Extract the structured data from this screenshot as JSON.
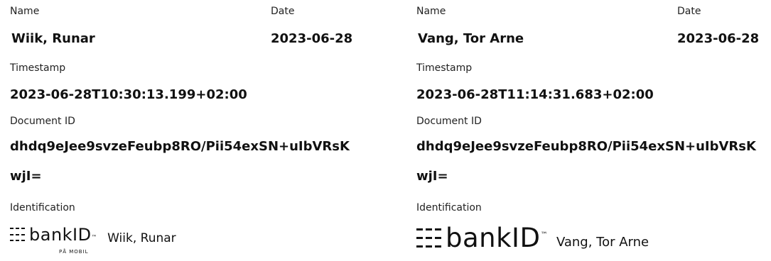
{
  "signatures": [
    {
      "name_label": "Name",
      "name": "Wiik, Runar",
      "date_label": "Date",
      "date": "2023-06-28",
      "timestamp_label": "Timestamp",
      "timestamp": "2023-06-28T10:30:13.199+02:00",
      "document_id_label": "Document ID",
      "document_id_line1": "dhdq9eJee9svzeFeubp8RO/Pii54exSN+uIbVRsK",
      "document_id_line2": "wjI=",
      "identification_label": "Identification",
      "logo_text": "bankID",
      "logo_sub": "PÅ MOBIL",
      "identified_name": "Wiik, Runar"
    },
    {
      "name_label": "Name",
      "name": "Vang, Tor Arne",
      "date_label": "Date",
      "date": "2023-06-28",
      "timestamp_label": "Timestamp",
      "timestamp": "2023-06-28T11:14:31.683+02:00",
      "document_id_label": "Document ID",
      "document_id_line1": "dhdq9eJee9svzeFeubp8RO/Pii54exSN+uIbVRsK",
      "document_id_line2": "wjI=",
      "identification_label": "Identification",
      "logo_text": "bankID",
      "identified_name": "Vang, Tor Arne"
    }
  ]
}
